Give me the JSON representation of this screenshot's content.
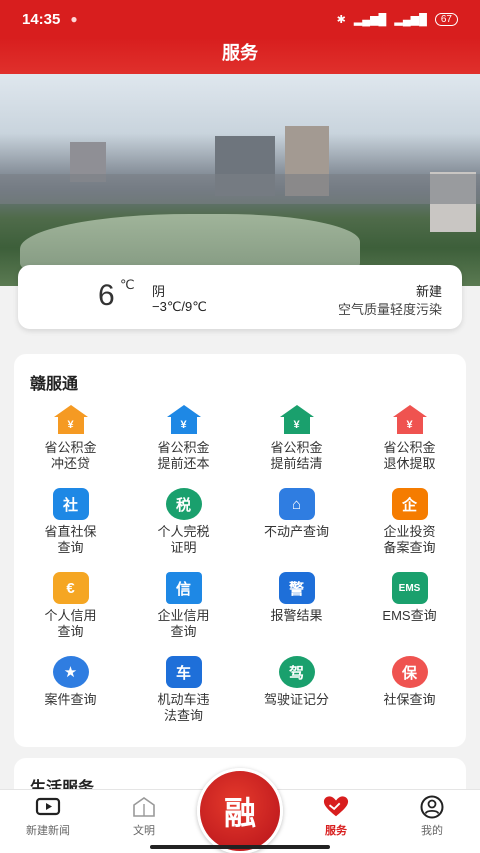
{
  "status_bar": {
    "time": "14:35",
    "battery": "67"
  },
  "header": {
    "title": "服务"
  },
  "weather": {
    "temperature": "6",
    "unit": "℃",
    "condition": "阴",
    "range": "−3℃/9℃",
    "city": "新建",
    "air_quality": "空气质量轻度污染"
  },
  "gan_fu_tong": {
    "title": "赣服通",
    "items": [
      {
        "label": "省公积金\n冲还贷",
        "icon": "housing-fund-repay-icon",
        "color": "#f59a23",
        "glyph": "¥"
      },
      {
        "label": "省公积金\n提前还本",
        "icon": "housing-fund-prepay-icon",
        "color": "#1e88e5",
        "glyph": "¥"
      },
      {
        "label": "省公积金\n提前结清",
        "icon": "housing-fund-settle-icon",
        "color": "#1aa06d",
        "glyph": "¥"
      },
      {
        "label": "省公积金\n退休提取",
        "icon": "housing-fund-retire-icon",
        "color": "#ef5350",
        "glyph": "¥"
      },
      {
        "label": "省直社保\n查询",
        "icon": "social-insurance-icon",
        "color": "#1e88e5",
        "glyph": "社"
      },
      {
        "label": "个人完税\n证明",
        "icon": "tax-certificate-icon",
        "color": "#1aa06d",
        "glyph": "税"
      },
      {
        "label": "不动产查询",
        "icon": "real-estate-icon",
        "color": "#2f7de1",
        "glyph": "⌂"
      },
      {
        "label": "企业投资\n备案查询",
        "icon": "enterprise-investment-icon",
        "color": "#f57c00",
        "glyph": "企"
      },
      {
        "label": "个人信用\n查询",
        "icon": "personal-credit-icon",
        "color": "#f5a623",
        "glyph": "€"
      },
      {
        "label": "企业信用\n查询",
        "icon": "enterprise-credit-icon",
        "color": "#1e88e5",
        "glyph": "信"
      },
      {
        "label": "报警结果",
        "icon": "police-report-icon",
        "color": "#1e6fd9",
        "glyph": "警"
      },
      {
        "label": "EMS查询",
        "icon": "ems-icon",
        "color": "#1aa06d",
        "glyph": "EMS"
      },
      {
        "label": "案件查询",
        "icon": "case-query-icon",
        "color": "#2f7de1",
        "glyph": "★"
      },
      {
        "label": "机动车违\n法查询",
        "icon": "vehicle-violation-icon",
        "color": "#1e6fd9",
        "glyph": "车"
      },
      {
        "label": "驾驶证记分",
        "icon": "driver-license-icon",
        "color": "#1aa06d",
        "glyph": "驾"
      },
      {
        "label": "社保查询",
        "icon": "social-security-query-icon",
        "color": "#ef5350",
        "glyph": "保"
      }
    ]
  },
  "life_services": {
    "title": "生活服务"
  },
  "tabbar": {
    "items": [
      {
        "label": "新建新闻",
        "icon": "video-news-icon"
      },
      {
        "label": "文明",
        "icon": "civilization-icon"
      },
      {
        "label": "融",
        "icon": "rong-center-icon"
      },
      {
        "label": "服务",
        "icon": "service-heart-icon"
      },
      {
        "label": "我的",
        "icon": "profile-icon"
      }
    ]
  }
}
